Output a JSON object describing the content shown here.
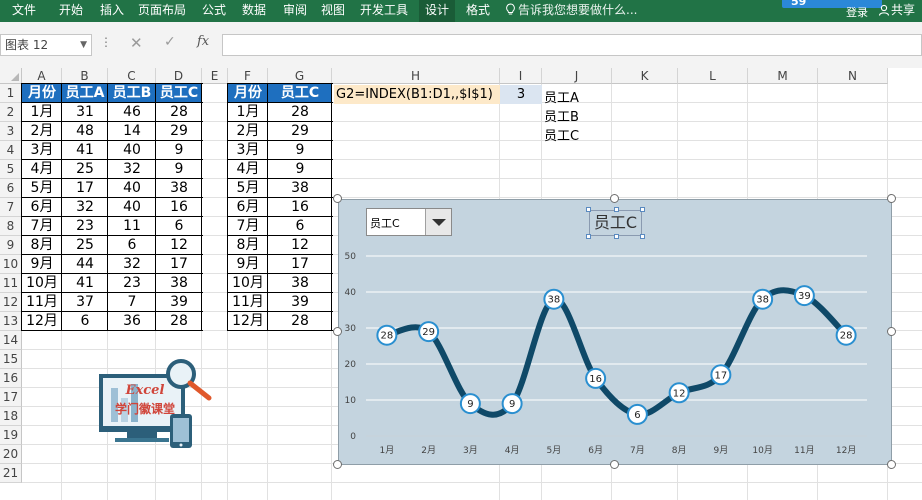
{
  "ribbon": {
    "tabs": [
      "文件",
      "开始",
      "插入",
      "页面布局",
      "公式",
      "数据",
      "审阅",
      "视图",
      "开发工具",
      "设计",
      "格式"
    ],
    "active_tab": "设计",
    "tell_me": "告诉我您想要做什么...",
    "badge_number": "59",
    "login": "登录",
    "share": "共享"
  },
  "formula_bar": {
    "name_box": "图表 12",
    "fx_label": "fx",
    "formula": ""
  },
  "grid": {
    "columns": [
      "A",
      "B",
      "C",
      "D",
      "E",
      "F",
      "G",
      "H",
      "I",
      "J",
      "K",
      "L",
      "M",
      "N"
    ],
    "rows": [
      "1",
      "2",
      "3",
      "4",
      "5",
      "6",
      "7",
      "8",
      "9",
      "10",
      "11",
      "12",
      "13",
      "14",
      "15",
      "16",
      "17",
      "18",
      "19",
      "20",
      "21"
    ]
  },
  "source_table": {
    "headers": [
      "月份",
      "员工A",
      "员工B",
      "员工C"
    ],
    "rows": [
      [
        "1月",
        "31",
        "46",
        "28"
      ],
      [
        "2月",
        "48",
        "14",
        "29"
      ],
      [
        "3月",
        "41",
        "40",
        "9"
      ],
      [
        "4月",
        "25",
        "32",
        "9"
      ],
      [
        "5月",
        "17",
        "40",
        "38"
      ],
      [
        "6月",
        "32",
        "40",
        "16"
      ],
      [
        "7月",
        "23",
        "11",
        "6"
      ],
      [
        "8月",
        "25",
        "6",
        "12"
      ],
      [
        "9月",
        "44",
        "32",
        "17"
      ],
      [
        "10月",
        "41",
        "23",
        "38"
      ],
      [
        "11月",
        "37",
        "7",
        "39"
      ],
      [
        "12月",
        "6",
        "36",
        "28"
      ]
    ]
  },
  "helper_table": {
    "headers": [
      "月份",
      "员工C"
    ],
    "rows": [
      [
        "1月",
        "28"
      ],
      [
        "2月",
        "29"
      ],
      [
        "3月",
        "9"
      ],
      [
        "4月",
        "9"
      ],
      [
        "5月",
        "38"
      ],
      [
        "6月",
        "16"
      ],
      [
        "7月",
        "6"
      ],
      [
        "8月",
        "12"
      ],
      [
        "9月",
        "17"
      ],
      [
        "10月",
        "38"
      ],
      [
        "11月",
        "39"
      ],
      [
        "12月",
        "28"
      ]
    ]
  },
  "notes": {
    "h1_formula": "G2=INDEX(B1:D1,,$I$1)",
    "i1_value": "3",
    "j_list": [
      "员工A",
      "员工B",
      "员工C"
    ]
  },
  "logo": {
    "line1": "Excel",
    "line2": "学门徽课堂"
  },
  "colors": {
    "ribbon_green": "#217346",
    "header_blue": "#1e6fbf",
    "chart_bg": "#c4d4df",
    "series_line": "#0f4968",
    "marker_ring": "#2a8fd0",
    "formula_cell_bg": "#fde9c9"
  },
  "chart_data": {
    "type": "line",
    "title": "员工C",
    "dropdown_selected": "员工C",
    "categories": [
      "1月",
      "2月",
      "3月",
      "4月",
      "5月",
      "6月",
      "7月",
      "8月",
      "9月",
      "10月",
      "11月",
      "12月"
    ],
    "series": [
      {
        "values": [
          28,
          29,
          9,
          9,
          38,
          16,
          6,
          12,
          17,
          38,
          39,
          28
        ]
      }
    ],
    "ylim": [
      0,
      50
    ],
    "yticks": [
      "0",
      "10",
      "20",
      "30",
      "40",
      "50"
    ],
    "smooth": true,
    "data_labels": true,
    "grid": true,
    "legend": "none"
  }
}
